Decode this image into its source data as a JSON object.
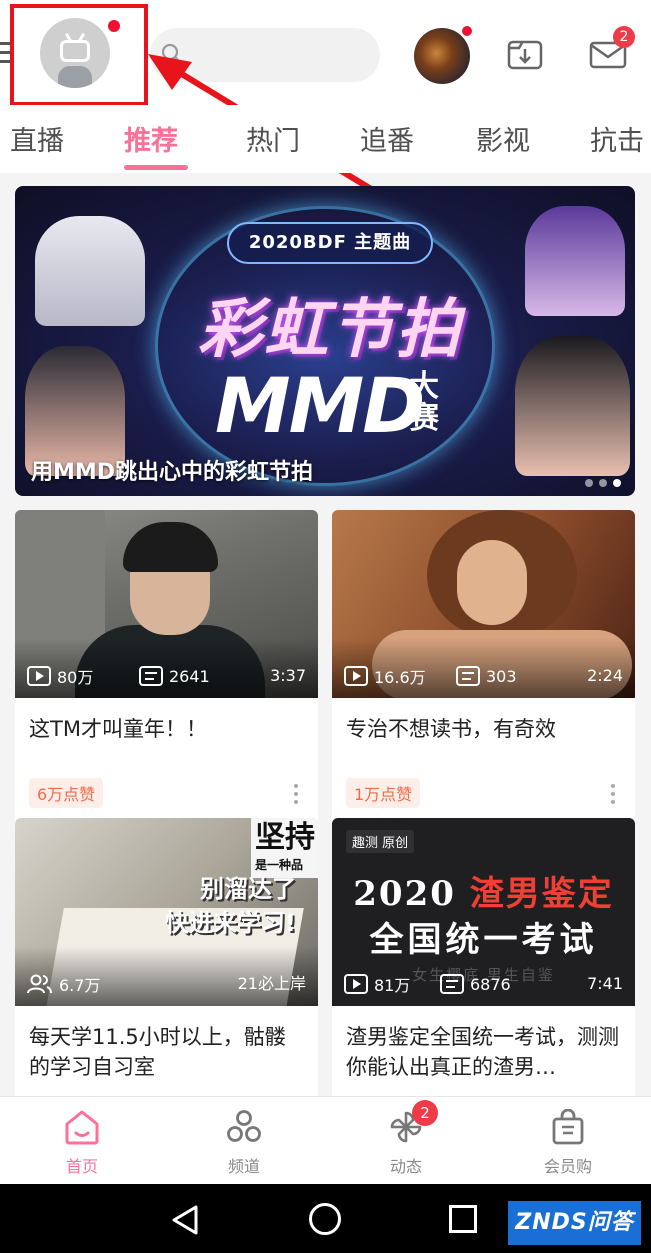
{
  "header": {
    "avatar_notification": true,
    "search": {
      "placeholder": ""
    },
    "mail_badge": "2",
    "accent_color": "#fb7299"
  },
  "tabs": [
    {
      "label": "直播",
      "active": false
    },
    {
      "label": "推荐",
      "active": true
    },
    {
      "label": "热门",
      "active": false
    },
    {
      "label": "追番",
      "active": false
    },
    {
      "label": "影视",
      "active": false
    },
    {
      "label": "抗击",
      "active": false
    }
  ],
  "banner": {
    "subtitle": "2020BDF 主题曲",
    "title": "彩虹节拍",
    "brand": "MMD",
    "brand_suffix": "大赛",
    "caption": "用MMD跳出心中的彩虹节拍",
    "dots_total": 3,
    "dots_active_index": 2
  },
  "cards": [
    {
      "title": "这TM才叫童年！！",
      "plays": "80万",
      "danmaku": "2641",
      "duration": "3:37",
      "likes": "6万点赞"
    },
    {
      "title": "专治不想读书，有奇效",
      "plays": "16.6万",
      "danmaku": "303",
      "duration": "2:24",
      "likes": "1万点赞"
    },
    {
      "title": "每天学11.5小时以上，骷髅的学习自习室",
      "viewers": "6.7万",
      "right_label": "21必上岸",
      "thumb_text_1": "别溜达了",
      "thumb_text_2": "快进来学习!",
      "thumb_sign": "坚持",
      "thumb_sign_sub": "是一种品"
    },
    {
      "title": "渣男鉴定全国统一考试，测测你能认出真正的渣男…",
      "plays": "81万",
      "danmaku": "6876",
      "duration": "7:41",
      "thumb_logo": "趣测 原创",
      "thumb_line1_a": "2020",
      "thumb_line1_b": "渣男鉴定",
      "thumb_line2": "全国统一考试",
      "thumb_line3": "女生樱底 男生自鉴"
    }
  ],
  "bottom_nav": [
    {
      "label": "首页",
      "icon": "home-icon",
      "active": true
    },
    {
      "label": "频道",
      "icon": "channel-icon",
      "active": false
    },
    {
      "label": "动态",
      "icon": "pinwheel-icon",
      "active": false,
      "badge": "2"
    },
    {
      "label": "会员购",
      "icon": "shopping-bag-icon",
      "active": false
    }
  ],
  "watermark": "ZNDS问答"
}
